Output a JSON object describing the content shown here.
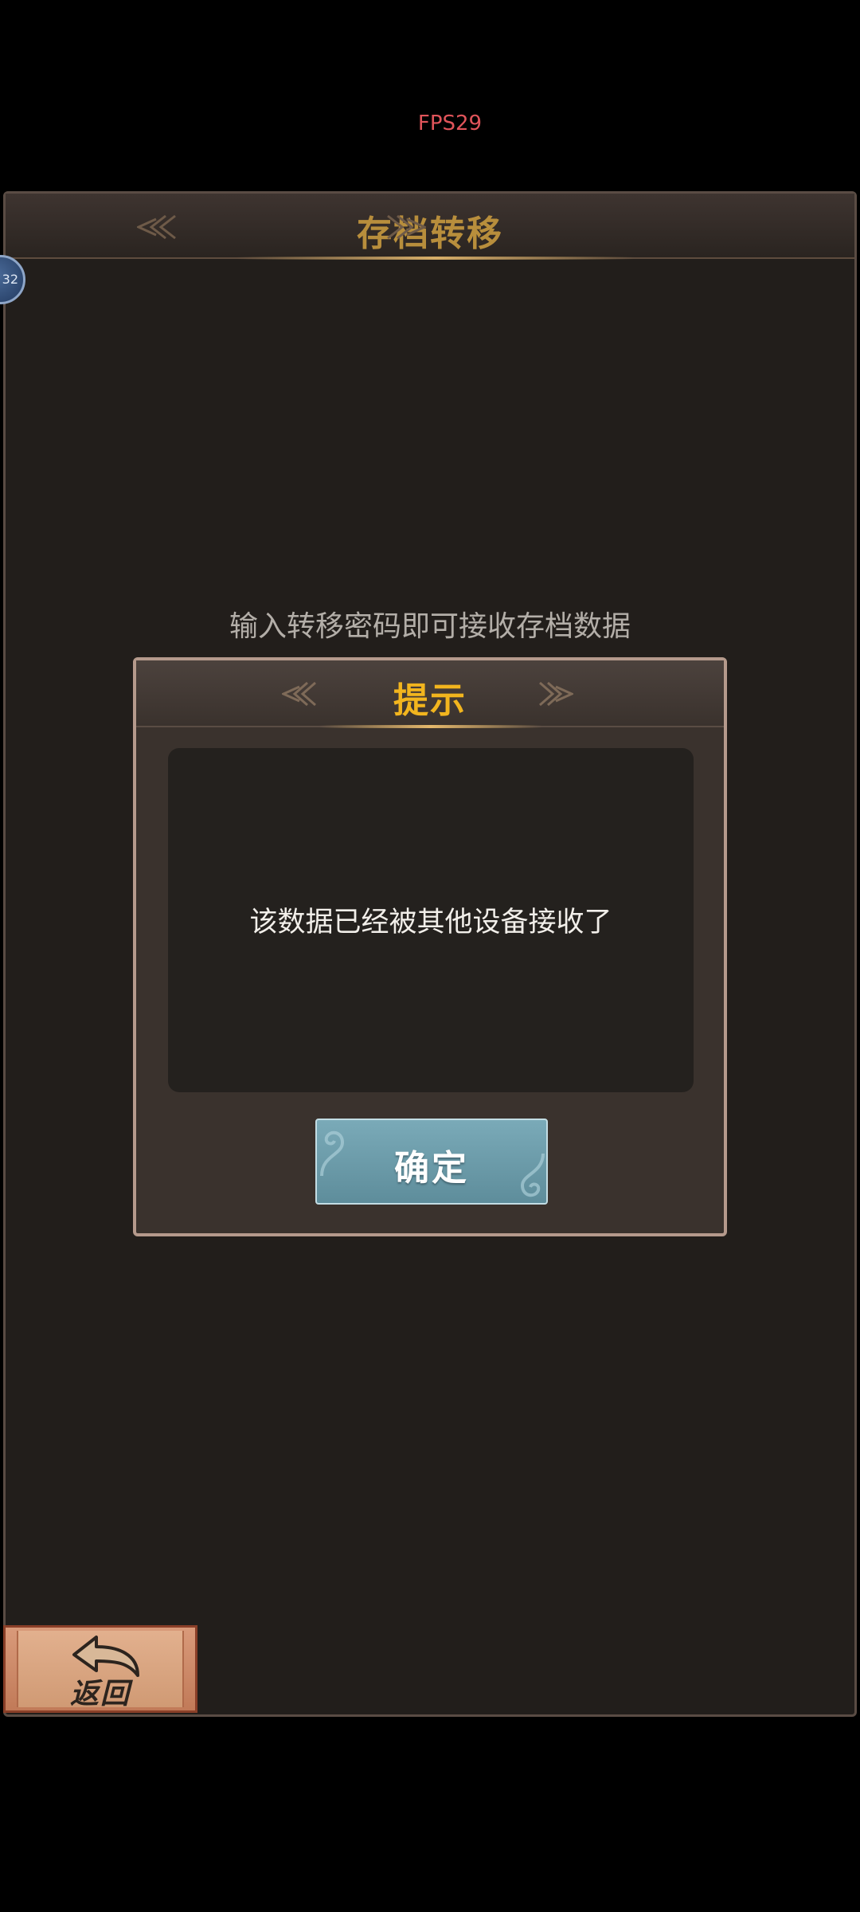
{
  "status": {
    "fps_text": "FPS29"
  },
  "panel": {
    "title": "存档转移",
    "badge_text": "32",
    "instruction": "输入转移密码即可接收存档数据"
  },
  "dialog": {
    "title": "提示",
    "message": "该数据已经被其他设备接收了",
    "confirm_label": "确定"
  },
  "back_button": {
    "label": "返回",
    "icon": "return-arrow-icon"
  },
  "colors": {
    "background": "#000000",
    "panel": "#221e1b",
    "panel_title": "#b88e3c",
    "dialog_title": "#f2b51e",
    "confirm_button": "#6e9ba9",
    "back_button": "#d09a74",
    "fps_text": "#e0545a"
  }
}
